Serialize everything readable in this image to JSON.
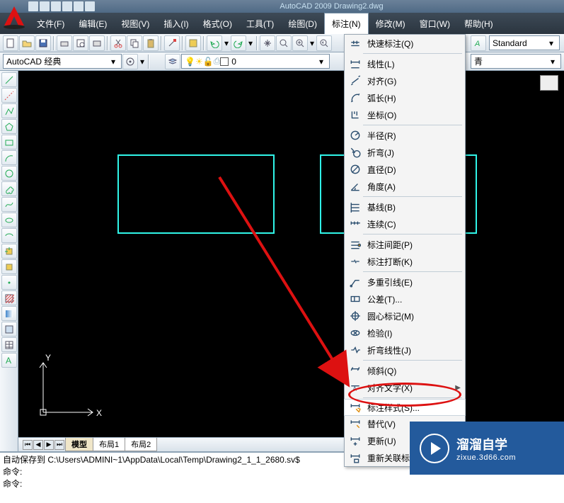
{
  "title": "AutoCAD 2009 Drawing2.dwg",
  "menubar": [
    {
      "label": "文件(F)",
      "hot": "F"
    },
    {
      "label": "编辑(E)",
      "hot": "E"
    },
    {
      "label": "视图(V)",
      "hot": "V"
    },
    {
      "label": "插入(I)",
      "hot": "I"
    },
    {
      "label": "格式(O)",
      "hot": "O"
    },
    {
      "label": "工具(T)",
      "hot": "T"
    },
    {
      "label": "绘图(D)",
      "hot": "D"
    },
    {
      "label": "标注(N)",
      "hot": "N",
      "open": true
    },
    {
      "label": "修改(M)",
      "hot": "M"
    },
    {
      "label": "窗口(W)",
      "hot": "W"
    },
    {
      "label": "帮助(H)",
      "hot": "H"
    }
  ],
  "workspace_combo": "AutoCAD 经典",
  "layer_combo": "0",
  "style_combo": "Standard",
  "color_combo": "青",
  "dropdown": {
    "groups": [
      [
        {
          "icon": "quick",
          "label": "快速标注(Q)"
        }
      ],
      [
        {
          "icon": "linear",
          "label": "线性(L)"
        },
        {
          "icon": "aligned",
          "label": "对齐(G)"
        },
        {
          "icon": "arc",
          "label": "弧长(H)"
        },
        {
          "icon": "ordinate",
          "label": "坐标(O)"
        }
      ],
      [
        {
          "icon": "radius",
          "label": "半径(R)"
        },
        {
          "icon": "jogged",
          "label": "折弯(J)"
        },
        {
          "icon": "diameter",
          "label": "直径(D)"
        },
        {
          "icon": "angular",
          "label": "角度(A)"
        }
      ],
      [
        {
          "icon": "baseline",
          "label": "基线(B)"
        },
        {
          "icon": "continue",
          "label": "连续(C)"
        }
      ],
      [
        {
          "icon": "dimspace",
          "label": "标注间距(P)"
        },
        {
          "icon": "dimbreak",
          "label": "标注打断(K)"
        }
      ],
      [
        {
          "icon": "mleader",
          "label": "多重引线(E)"
        },
        {
          "icon": "tolerance",
          "label": "公差(T)..."
        },
        {
          "icon": "center",
          "label": "圆心标记(M)"
        },
        {
          "icon": "inspect",
          "label": "检验(I)"
        },
        {
          "icon": "joggedlin",
          "label": "折弯线性(J)"
        }
      ],
      [
        {
          "icon": "oblique",
          "label": "倾斜(Q)"
        },
        {
          "icon": "textalign",
          "label": "对齐文字(X)",
          "sub": true
        }
      ],
      [
        {
          "icon": "dimstyle",
          "label": "标注样式(S)...",
          "highlight": true
        },
        {
          "icon": "override",
          "label": "替代(V)"
        },
        {
          "icon": "update",
          "label": "更新(U)"
        },
        {
          "icon": "reassoc",
          "label": "重新关联标注(N)"
        }
      ]
    ]
  },
  "tabs": {
    "active": "模型",
    "items": [
      "模型",
      "布局1",
      "布局2"
    ]
  },
  "cmd": {
    "line1": "自动保存到 C:\\Users\\ADMINI~1\\AppData\\Local\\Temp\\Drawing2_1_1_2680.sv$",
    "line2": "命令:",
    "line3": "命令:"
  },
  "ucs": {
    "x": "X",
    "y": "Y"
  },
  "watermark": {
    "main": "溜溜自学",
    "sub": "zixue.3d66.com"
  },
  "left_tools": [
    "line",
    "construction-line",
    "polyline",
    "polygon",
    "rectangle",
    "arc",
    "circle",
    "revcloud",
    "spline",
    "ellipse",
    "ellipse-arc",
    "block-insert",
    "make-block",
    "point",
    "hatch",
    "gradient",
    "region",
    "table",
    "text"
  ]
}
